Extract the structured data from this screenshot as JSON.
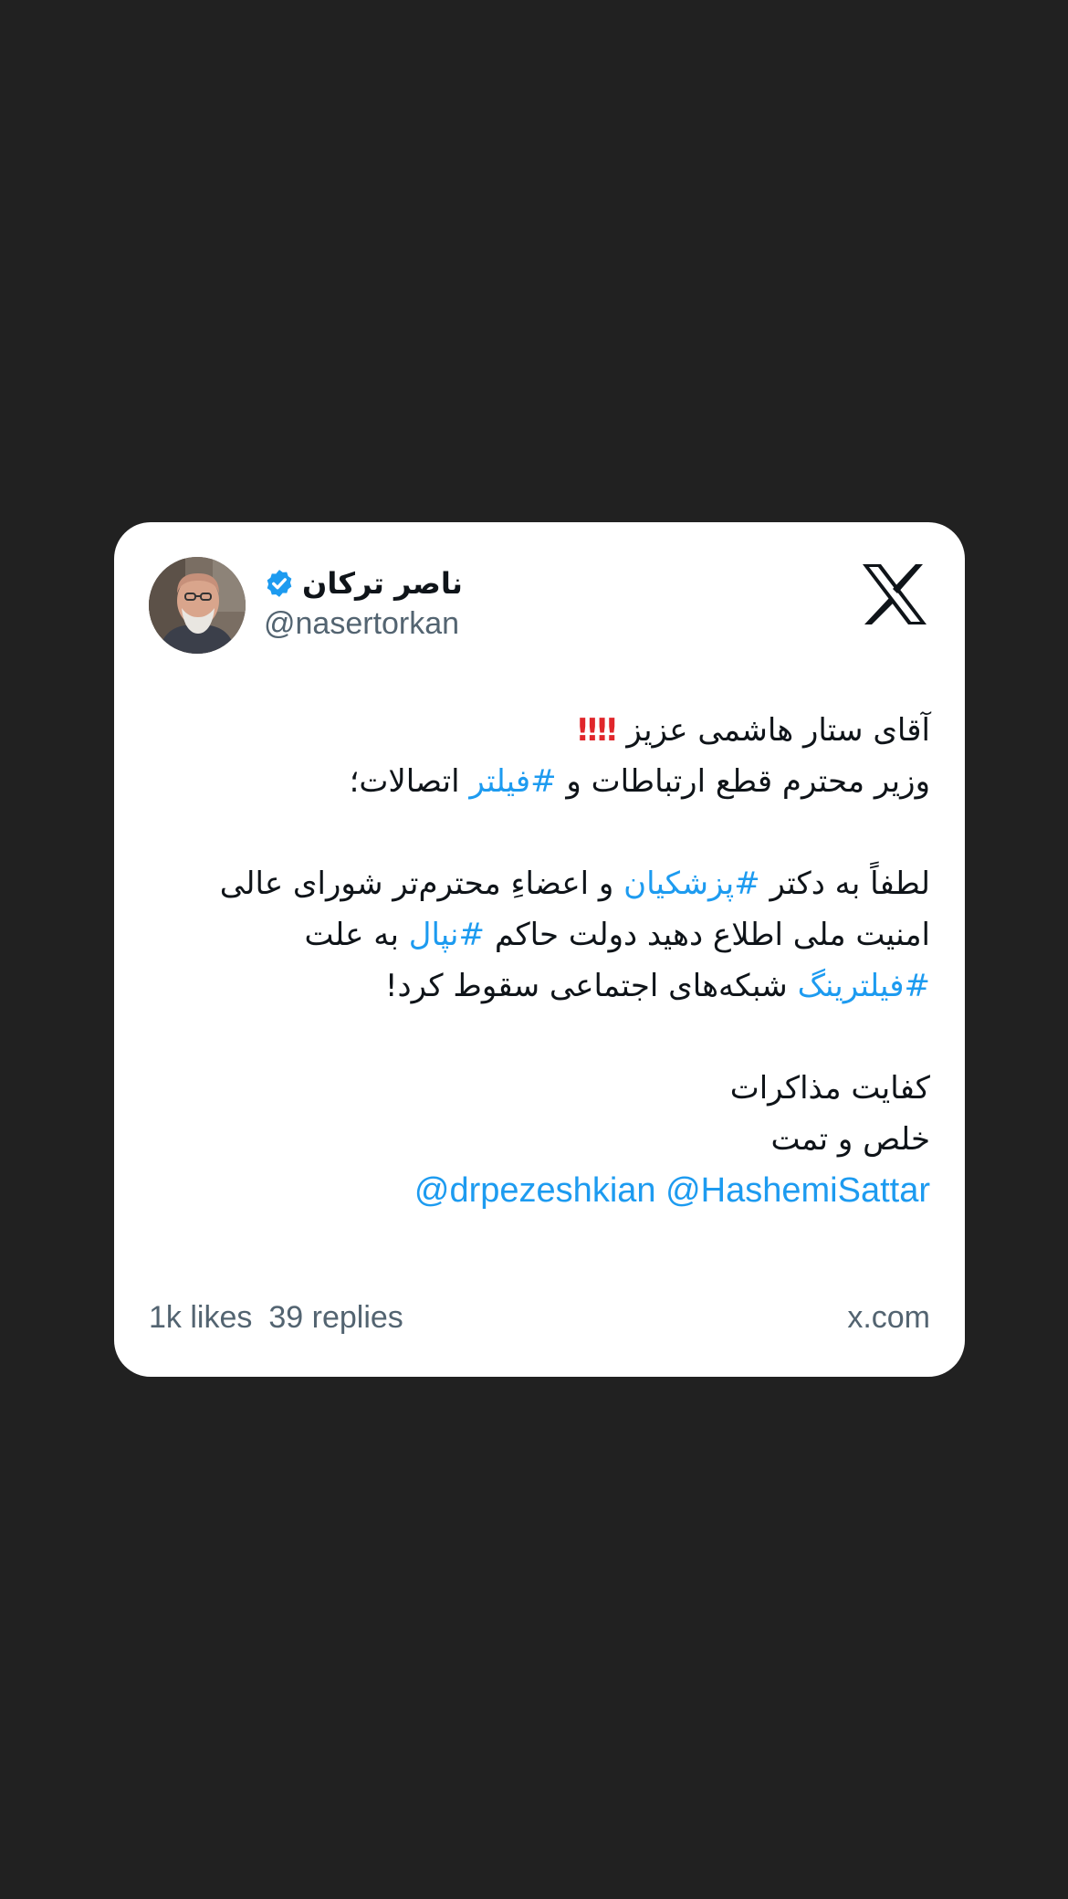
{
  "author": {
    "name": "ناصر ترکان",
    "handle": "@nasertorkan",
    "verified": true
  },
  "tweet": {
    "line1_text": "آقای ستار هاشمی عزیز",
    "line1_emoji": "‼",
    "line2_part1": "وزیر محترم قطع ارتباطات و ",
    "line2_hashtag": "#فیلتر",
    "line2_part2": " اتصالات؛",
    "line3_part1": "لطفاً به دکتر ",
    "line3_hashtag": "#پزشکیان",
    "line3_part2": " و اعضاءِ محترم‌تر شورای عالی",
    "line4_part1": "امنیت ملی اطلاع دهید دولت حاکم ",
    "line4_hashtag": "#نپال",
    "line4_part2": " به علت",
    "line5_hashtag": "#فیلترینگ",
    "line5_part2": " شبکه‌های اجتماعی سقوط کرد!",
    "line6": "کفایت مذاکرات",
    "line7": "خلص و تمت",
    "mention1": "@drpezeshkian",
    "mention2": "@HashemiSattar"
  },
  "footer": {
    "likes": "1k likes",
    "replies": "39 replies",
    "source": "x.com"
  },
  "colors": {
    "background": "#212121",
    "card": "#ffffff",
    "link": "#1d9bf0",
    "muted": "#536471",
    "text": "#0f1419",
    "verified_badge": "#1d9bf0",
    "emoji_red": "#e0262b"
  },
  "icons": {
    "brand": "x-logo-icon",
    "badge": "verified-badge-icon"
  }
}
